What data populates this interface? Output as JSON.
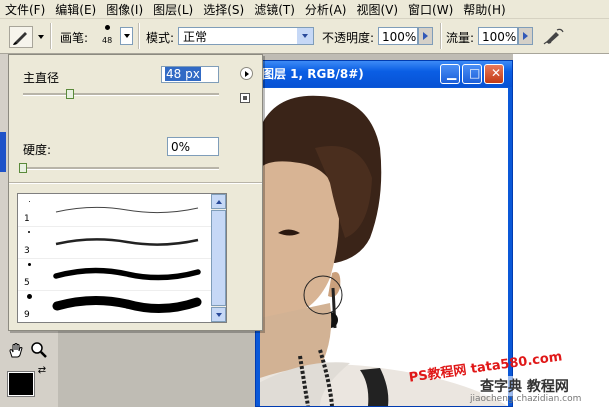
{
  "menubar": {
    "items": [
      "文件(F)",
      "编辑(E)",
      "图像(I)",
      "图层(L)",
      "选择(S)",
      "滤镜(T)",
      "分析(A)",
      "视图(V)",
      "窗口(W)",
      "帮助(H)"
    ]
  },
  "optionsbar": {
    "brush_label": "画笔:",
    "brush_size": "48",
    "mode_label": "模式:",
    "mode_value": "正常",
    "opacity_label": "不透明度:",
    "opacity_value": "100%",
    "flow_label": "流量:",
    "flow_value": "100%"
  },
  "brush_panel": {
    "diameter_label": "主直径",
    "diameter_value": "48 px",
    "diameter_slider": 0.24,
    "hardness_label": "硬度:",
    "hardness_value": "0%",
    "hardness_slider": 0.0,
    "presets": [
      {
        "number": "1"
      },
      {
        "number": "3"
      },
      {
        "number": "5"
      },
      {
        "number": "9"
      }
    ]
  },
  "image_window": {
    "title": "图层 1, RGB/8#)"
  },
  "watermark": {
    "ps": "PS教程网 tata580.com",
    "site": "查字典 教程网",
    "url": "jiaocheng.chazidian.com"
  },
  "colors": {
    "menubar_bg": "#ece9d8",
    "xp_blue": "#0a58d8",
    "slider_green": "#5a8a3a",
    "watermark_red": "#e01818"
  },
  "icons": [
    "brush-icon",
    "airbrush-icon",
    "hand-icon",
    "zoom-icon",
    "swap-colors-icon",
    "panel-menu-icon"
  ]
}
